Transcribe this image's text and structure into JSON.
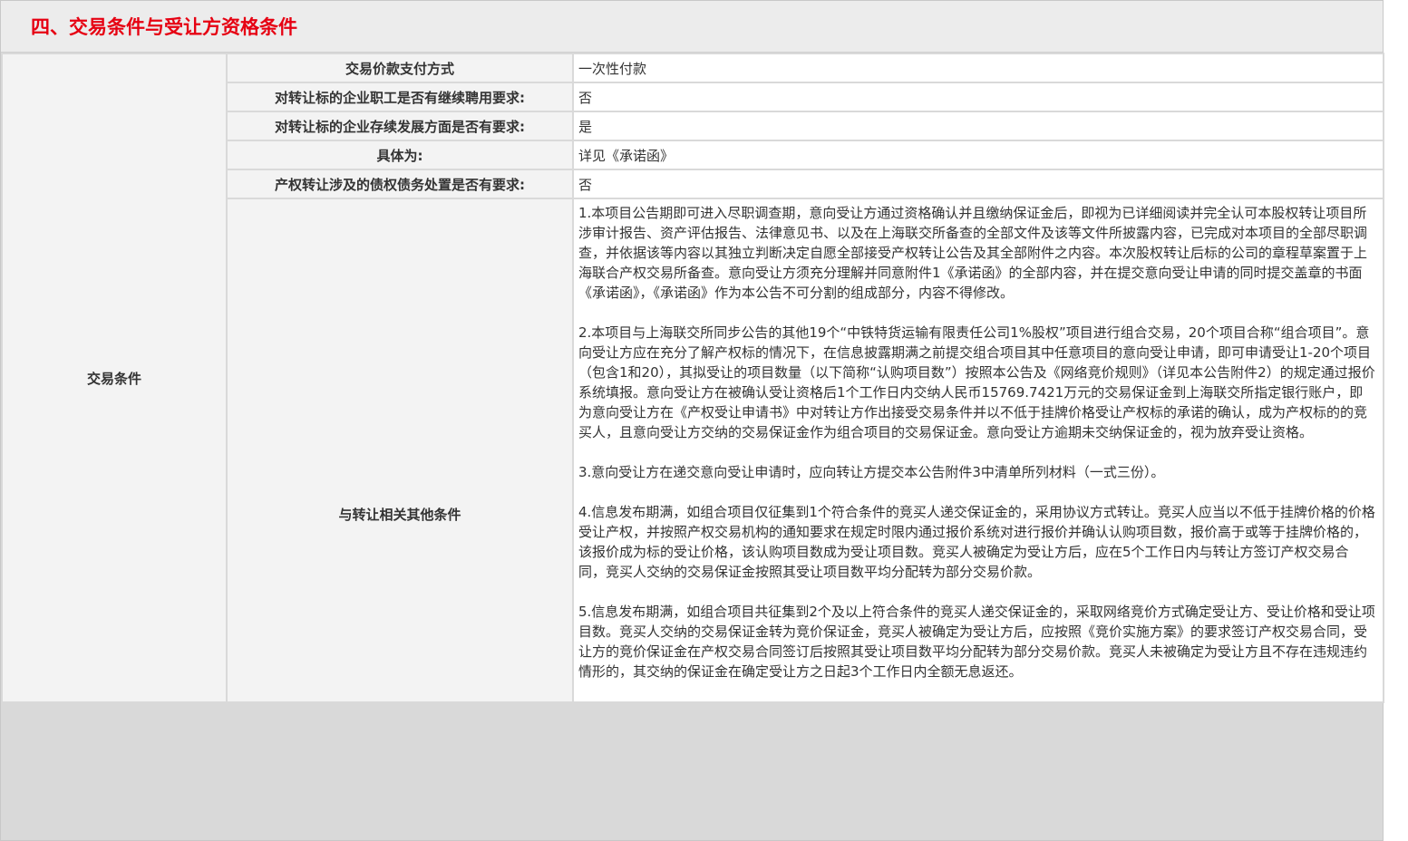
{
  "section_title": "四、交易条件与受让方资格条件",
  "category": "交易条件",
  "rows": [
    {
      "label": "交易价款支付方式",
      "value": "一次性付款"
    },
    {
      "label": "对转让标的企业职工是否有继续聘用要求:",
      "value": "否"
    },
    {
      "label": "对转让标的企业存续发展方面是否有要求:",
      "value": "是"
    },
    {
      "label": "具体为:",
      "value": "详见《承诺函》"
    },
    {
      "label": "产权转让涉及的债权债务处置是否有要求:",
      "value": "否"
    }
  ],
  "other_conditions": {
    "label": "与转让相关其他条件",
    "paragraphs": [
      "1.本项目公告期即可进入尽职调查期，意向受让方通过资格确认并且缴纳保证金后，即视为已详细阅读并完全认可本股权转让项目所涉审计报告、资产评估报告、法律意见书、以及在上海联交所备查的全部文件及该等文件所披露内容，已完成对本项目的全部尽职调查，并依据该等内容以其独立判断决定自愿全部接受产权转让公告及其全部附件之内容。本次股权转让后标的公司的章程草案置于上海联合产权交易所备查。意向受让方须充分理解并同意附件1《承诺函》的全部内容，并在提交意向受让申请的同时提交盖章的书面《承诺函》，《承诺函》作为本公告不可分割的组成部分，内容不得修改。",
      "2.本项目与上海联交所同步公告的其他19个“中铁特货运输有限责任公司1%股权”项目进行组合交易，20个项目合称“组合项目”。意向受让方应在充分了解产权标的情况下，在信息披露期满之前提交组合项目其中任意项目的意向受让申请，即可申请受让1-20个项目（包含1和20），其拟受让的项目数量（以下简称“认购项目数”）按照本公告及《网络竞价规则》（详见本公告附件2）的规定通过报价系统填报。意向受让方在被确认受让资格后1个工作日内交纳人民币15769.7421万元的交易保证金到上海联交所指定银行账户，即为意向受让方在《产权受让申请书》中对转让方作出接受交易条件并以不低于挂牌价格受让产权标的承诺的确认，成为产权标的的竞买人，且意向受让方交纳的交易保证金作为组合项目的交易保证金。意向受让方逾期未交纳保证金的，视为放弃受让资格。",
      "3.意向受让方在递交意向受让申请时，应向转让方提交本公告附件3中清单所列材料（一式三份）。",
      "4.信息发布期满，如组合项目仅征集到1个符合条件的竞买人递交保证金的，采用协议方式转让。竞买人应当以不低于挂牌价格的价格受让产权，并按照产权交易机构的通知要求在规定时限内通过报价系统对进行报价并确认认购项目数，报价高于或等于挂牌价格的，该报价成为标的受让价格，该认购项目数成为受让项目数。竞买人被确定为受让方后，应在5个工作日内与转让方签订产权交易合同，竞买人交纳的交易保证金按照其受让项目数平均分配转为部分交易价款。",
      "5.信息发布期满，如组合项目共征集到2个及以上符合条件的竞买人递交保证金的，采取网络竞价方式确定受让方、受让价格和受让项目数。竞买人交纳的交易保证金转为竞价保证金，竞买人被确定为受让方后，应按照《竞价实施方案》的要求签订产权交易合同，受让方的竞价保证金在产权交易合同签订后按照其受让项目数平均分配转为部分交易价款。竞买人未被确定为受让方且不存在违规违约情形的，其交纳的保证金在确定受让方之日起3个工作日内全额无息返还。"
    ]
  }
}
